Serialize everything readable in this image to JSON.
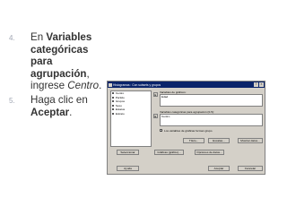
{
  "steps": [
    {
      "number": "4.",
      "parts": [
        {
          "t": "En ",
          "s": "n"
        },
        {
          "t": "Variables categóricas para agrupación",
          "s": "b"
        },
        {
          "t": ", ingrese ",
          "s": "n"
        },
        {
          "t": "Centro",
          "s": "i"
        },
        {
          "t": ".",
          "s": "n"
        }
      ]
    },
    {
      "number": "5.",
      "parts": [
        {
          "t": "Haga clic en ",
          "s": "n"
        },
        {
          "t": "Aceptar",
          "s": "b"
        },
        {
          "t": ".",
          "s": "n"
        }
      ]
    }
  ],
  "dialog": {
    "title": "Histogramas : Con subsets y grupos",
    "title_buttons": [
      "?",
      "×"
    ],
    "variables": [
      "Centro",
      "Partido",
      "Grupos",
      "Sexo",
      "Estatus",
      "Estrato"
    ],
    "graph_vars_label": "Variables de gráficos:",
    "graph_vars_value": "Edad",
    "group_vars_label": "Variables categóricas para agrupación (0-5):",
    "group_vars_value": "Centro",
    "checkbox_label": "Los variables de gráficas forman grupo",
    "checkbox_mark": "✓",
    "arrow_glyph": "►",
    "buttons": {
      "title": "Título...",
      "scale": "Escalas...",
      "show_data": "Mostrar datos...",
      "select": "Seleccionar",
      "graph_options": "Gráficas (gráfico)...",
      "data_options": "Opciones de datos...",
      "help": "Ayuda",
      "ok": "Aceptar",
      "cancel": "Cancelar"
    }
  }
}
